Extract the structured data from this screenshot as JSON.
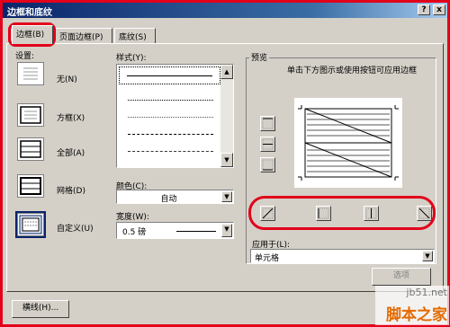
{
  "dialog": {
    "title": "边框和底纹",
    "help_glyph": "?",
    "close_glyph": "x"
  },
  "tabs": [
    {
      "label": "边框(B)",
      "active": true
    },
    {
      "label": "页面边框(P)",
      "active": false
    },
    {
      "label": "底纹(S)",
      "active": false
    }
  ],
  "settings": {
    "heading": "设置:",
    "items": [
      {
        "label": "无(N)"
      },
      {
        "label": "方框(X)"
      },
      {
        "label": "全部(A)"
      },
      {
        "label": "网格(D)"
      },
      {
        "label": "自定义(U)",
        "selected": true
      }
    ]
  },
  "style": {
    "heading": "样式(Y):",
    "line_styles": [
      "solid",
      "dotted",
      "dotted-fine",
      "dashed",
      "dash-dot"
    ]
  },
  "color": {
    "label": "颜色(C):",
    "value": "自动"
  },
  "width": {
    "label": "宽度(W):",
    "value": "0.5 磅"
  },
  "preview": {
    "heading": "预览",
    "instruction": "单击下方图示或使用按钮可应用边框"
  },
  "apply_to": {
    "label": "应用于(L):",
    "value": "单元格"
  },
  "buttons": {
    "options": "选项",
    "horizontal_line": "横线(H)..."
  },
  "watermark": {
    "site": "jb51.net",
    "brand": "脚本之家"
  },
  "colors": {
    "highlight": "#e2001a",
    "title_bar": "#0a246a",
    "dialog_bg": "#d4d0c8"
  }
}
